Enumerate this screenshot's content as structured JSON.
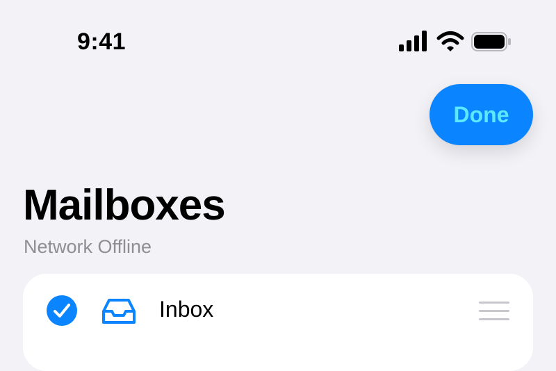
{
  "status_bar": {
    "time": "9:41",
    "icons": [
      "signal-icon",
      "wifi-icon",
      "battery-icon"
    ]
  },
  "header": {
    "done_label": "Done",
    "title": "Mailboxes",
    "subtitle": "Network Offline"
  },
  "mailboxes": [
    {
      "label": "Inbox",
      "selected": true,
      "icon": "inbox-icon"
    }
  ],
  "colors": {
    "background": "#f2f2f7",
    "accent": "#0a84ff",
    "done_text": "#5ce8ff",
    "secondary_text": "#8e8e93",
    "card": "#ffffff",
    "reorder": "#c7c7cc"
  }
}
